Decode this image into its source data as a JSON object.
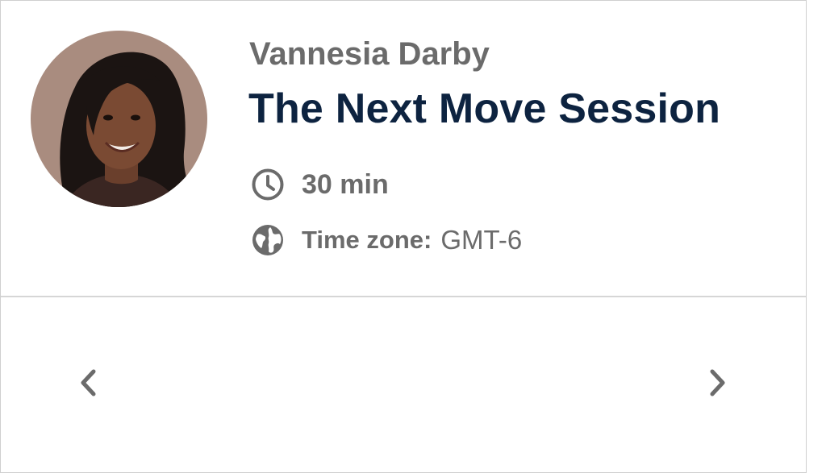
{
  "host": {
    "name": "Vannesia Darby",
    "avatar_icon": "host-avatar-photo"
  },
  "event": {
    "title": "The Next Move Session",
    "duration": "30 min",
    "duration_icon": "clock-icon",
    "timezone_label": "Time zone:",
    "timezone_value": "GMT-6",
    "timezone_icon": "globe-icon"
  },
  "navigation": {
    "prev_icon": "chevron-left-icon",
    "next_icon": "chevron-right-icon"
  },
  "colors": {
    "title": "#0d2340",
    "text_muted": "#6b6b6b",
    "divider": "#d6d6d6",
    "border": "#cfcfcf"
  }
}
